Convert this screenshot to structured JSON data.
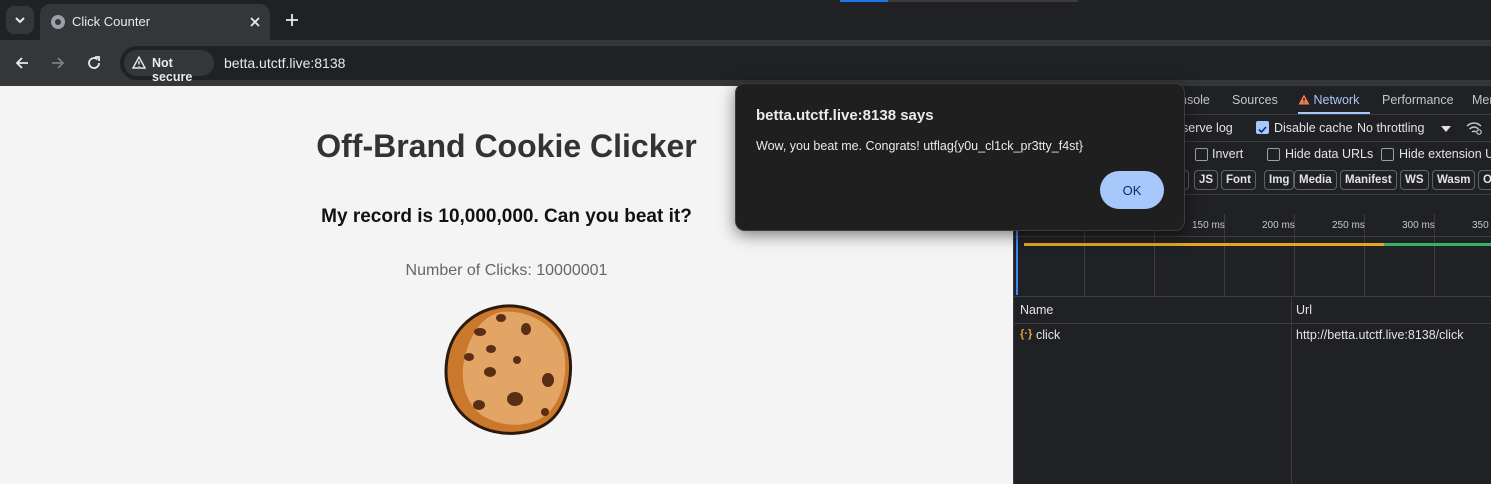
{
  "browser": {
    "tab_title": "Click Counter",
    "security_label": "Not secure",
    "url": "betta.utctf.live:8138"
  },
  "page": {
    "title": "Off-Brand Cookie Clicker",
    "record_text": "My record is 10,000,000. Can you beat it?",
    "counter_text": "Number of Clicks: 10000001"
  },
  "devtools": {
    "tabs": [
      "nsole",
      "Sources",
      "Network",
      "Performance",
      "Mer"
    ],
    "active_tab": "Network",
    "preserve_log_label": "serve log",
    "disable_cache_label": "Disable cache",
    "throttling_value": "No throttling",
    "filters": {
      "invert_label": "Invert",
      "hide_data_urls_label": "Hide data URLs",
      "hide_extension_label": "Hide extension UR"
    },
    "type_chips": [
      "JS",
      "Font",
      "Img",
      "Media",
      "Manifest",
      "WS",
      "Wasm",
      "O"
    ],
    "timeline_ticks": [
      "150 ms",
      "200 ms",
      "250 ms",
      "300 ms",
      "350"
    ],
    "columns": {
      "name": "Name",
      "url": "Url"
    },
    "requests": [
      {
        "name": "click",
        "url": "http://betta.utctf.live:8138/click"
      }
    ]
  },
  "dialog": {
    "title": "betta.utctf.live:8138 says",
    "message": "Wow, you beat me. Congrats! utflag{y0u_cl1ck_pr3tty_f4st}",
    "ok_label": "OK"
  },
  "colors": {
    "accent": "#a8c7fa",
    "page_bg": "#f4f4f4",
    "cookie": "#e0a05a"
  }
}
